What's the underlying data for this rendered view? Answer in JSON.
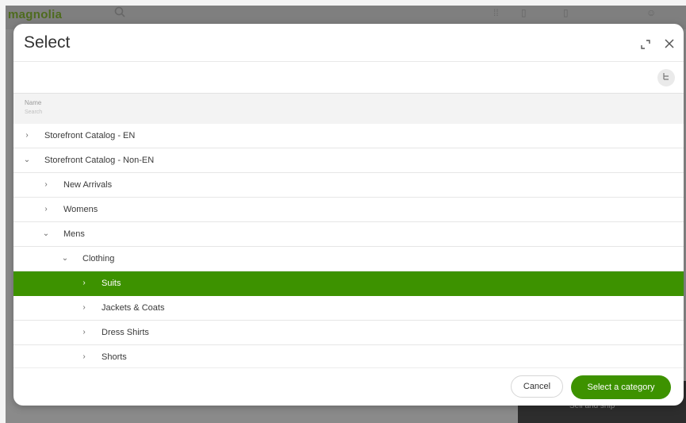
{
  "background_app": {
    "logo": "magnolia",
    "search_icon": "search-icon",
    "bottom_panel_text": "Sell and ship"
  },
  "dialog": {
    "title": "Select",
    "maximize_icon": "maximize-icon",
    "close_icon": "close-icon",
    "toolbar_icon": "tree-view-icon"
  },
  "table": {
    "column_header": "Name",
    "filter_placeholder": "Search",
    "rows": [
      {
        "label": "Storefront Catalog - EN",
        "expanded": false,
        "selected": false
      },
      {
        "label": "Storefront Catalog - Non-EN",
        "expanded": true,
        "selected": false
      },
      {
        "label": "New Arrivals",
        "expanded": false,
        "selected": false
      },
      {
        "label": "Womens",
        "expanded": false,
        "selected": false
      },
      {
        "label": "Mens",
        "expanded": true,
        "selected": false
      },
      {
        "label": "Clothing",
        "expanded": true,
        "selected": false
      },
      {
        "label": "Suits",
        "expanded": false,
        "selected": true
      },
      {
        "label": "Jackets & Coats",
        "expanded": false,
        "selected": false
      },
      {
        "label": "Dress Shirts",
        "expanded": false,
        "selected": false
      },
      {
        "label": "Shorts",
        "expanded": false,
        "selected": false
      }
    ]
  },
  "footer": {
    "cancel_label": "Cancel",
    "select_label": "Select a category"
  },
  "colors": {
    "accent": "#3d9200",
    "selected_row": "#3d9200"
  }
}
